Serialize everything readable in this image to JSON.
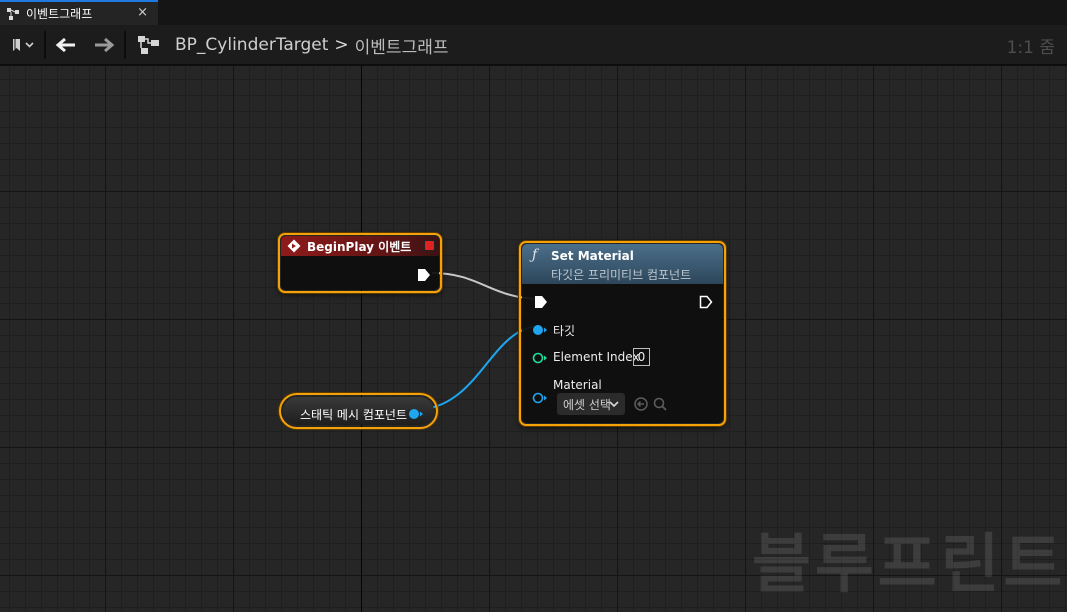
{
  "tab": {
    "label": "이벤트그래프",
    "close": "×"
  },
  "breadcrumb": {
    "root": "BP_CylinderTarget",
    "separator": ">",
    "current": "이벤트그래프"
  },
  "zoom": {
    "label": "1:1 줌"
  },
  "nodes": {
    "begin_play": {
      "title": "BeginPlay 이벤트"
    },
    "set_material": {
      "title": "Set Material",
      "subtitle": "타깃은 프리미티브 컴포넌트",
      "pins": {
        "target": "타깃",
        "element_index": "Element Index",
        "element_index_value": "0",
        "material": "Material",
        "material_select": "에셋 선택"
      }
    },
    "static_mesh": {
      "label": "스태틱 메시 컴포넌트"
    }
  },
  "watermark": "블루프린트",
  "colors": {
    "selection": "#f5a20a",
    "exec_wire": "#c8c8c8",
    "object_pin": "#1ea7f0",
    "integer_pin": "#1fe0a0",
    "event_header": "#8f1b1b",
    "function_header": "#4b6f8a",
    "tab_accent": "#1f7ae0"
  }
}
